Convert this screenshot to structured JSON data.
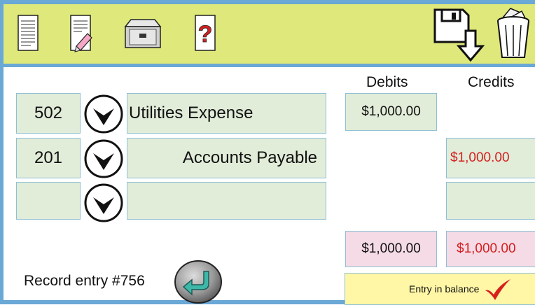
{
  "toolbar": {
    "icons": [
      "new-document-icon",
      "edit-document-icon",
      "file-cabinet-icon",
      "help-icon",
      "save-icon",
      "trash-icon"
    ],
    "help_glyph": "?"
  },
  "columns": {
    "debits": "Debits",
    "credits": "Credits"
  },
  "rows": [
    {
      "account": "502",
      "name": "Utilities Expense",
      "debit": "$1,000.00",
      "credit": ""
    },
    {
      "account": "201",
      "name": "Accounts Payable",
      "debit": "",
      "credit": "$1,000.00"
    },
    {
      "account": "",
      "name": "",
      "debit": "",
      "credit": ""
    }
  ],
  "totals": {
    "debit": "$1,000.00",
    "credit": "$1,000.00"
  },
  "record": {
    "label": "Record entry #756"
  },
  "status": {
    "text": "Entry in balance"
  },
  "colors": {
    "toolbar": "#dfe87a",
    "frame": "#6aa8d6",
    "field": "#e1ecd9",
    "total": "#f5dbe6",
    "credit_text": "#d42020",
    "status": "#fff7a6",
    "check": "#d8201c"
  }
}
